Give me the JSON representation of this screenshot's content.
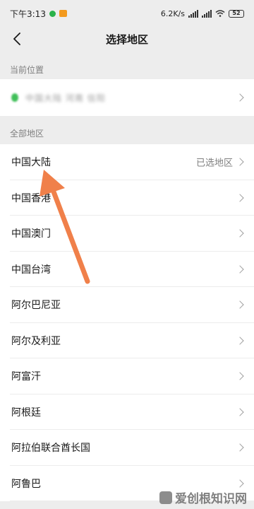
{
  "status_bar": {
    "time": "下午3:13",
    "speed": "6.2K/s",
    "battery": "52"
  },
  "nav": {
    "title": "选择地区",
    "back_icon": "chevron-left-icon"
  },
  "current_section": {
    "label": "当前位置",
    "location_text": "中国大陆 河南 信阳"
  },
  "all_section": {
    "label": "全部地区",
    "regions": [
      {
        "name": "中国大陆",
        "note": "已选地区"
      },
      {
        "name": "中国香港",
        "note": ""
      },
      {
        "name": "中国澳门",
        "note": ""
      },
      {
        "name": "中国台湾",
        "note": ""
      },
      {
        "name": "阿尔巴尼亚",
        "note": ""
      },
      {
        "name": "阿尔及利亚",
        "note": ""
      },
      {
        "name": "阿富汗",
        "note": ""
      },
      {
        "name": "阿根廷",
        "note": ""
      },
      {
        "name": "阿拉伯联合酋长国",
        "note": ""
      },
      {
        "name": "阿鲁巴",
        "note": ""
      }
    ]
  },
  "watermark": {
    "text": "爱创根知识网"
  },
  "colors": {
    "background": "#ededed",
    "annotation_arrow": "#f0804a",
    "location_pin": "#3fbf58"
  }
}
